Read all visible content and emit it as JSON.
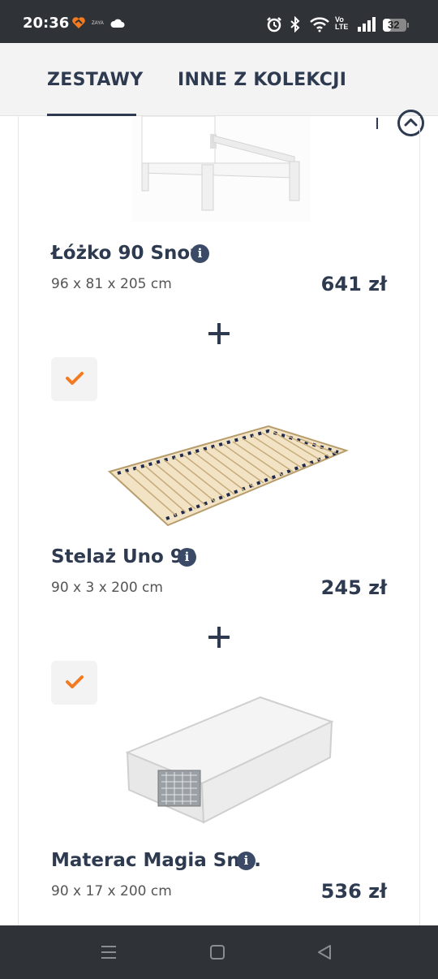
{
  "status_bar": {
    "time": "20:36",
    "battery": "32",
    "icons": [
      "app-heart-icon",
      "zaya-icon",
      "cloud-icon",
      "alarm-icon",
      "bluetooth-icon",
      "wifi-icon",
      "volte-icon",
      "signal-icon",
      "battery-icon"
    ]
  },
  "tabs": [
    {
      "label": "ZESTAWY",
      "active": true
    },
    {
      "label": "INNE Z KOLEKCJI",
      "active": false
    }
  ],
  "products": [
    {
      "name": "Łóżko 90 Snow",
      "dims": "96 x 81 x 205 cm",
      "price": "641 zł",
      "image": "bed-frame-image",
      "checked": null
    },
    {
      "name": "Stelaż Uno 90",
      "dims": "90 x 3 x 200 cm",
      "price": "245 zł",
      "image": "slatted-base-image",
      "checked": true
    },
    {
      "name": "Materac Magia Sn...",
      "dims": "90 x 17 x 200 cm",
      "price": "536 zł",
      "image": "mattress-image",
      "checked": true
    }
  ],
  "colors": {
    "text_primary": "#2e3a50",
    "check_accent": "#f47a20",
    "bar_dark": "#2f3237"
  },
  "nav_buttons": [
    "menu-icon",
    "home-square-icon",
    "back-triangle-icon"
  ]
}
